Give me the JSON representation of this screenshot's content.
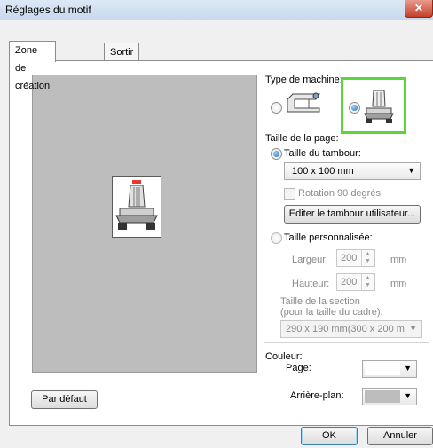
{
  "window": {
    "title": "Réglages du motif",
    "close_label": "✕"
  },
  "tabs": [
    {
      "label": "Zone de création"
    },
    {
      "label": "Sortir"
    }
  ],
  "machine_type": {
    "label": "Type de machine:",
    "options": [
      "flatbed-machine",
      "cap-machine"
    ],
    "selected": "cap-machine"
  },
  "page_size": {
    "label": "Taille de la page:",
    "hoop_size_label": "Taille du tambour:",
    "hoop_size_value": "100 x 100 mm",
    "rotation_label": "Rotation 90 degrés",
    "edit_hoop_button": "Editer le tambour utilisateur...",
    "custom_size_label": "Taille personnalisée:",
    "width_label": "Largeur:",
    "width_value": "200",
    "width_unit": "mm",
    "height_label": "Hauteur:",
    "height_value": "200",
    "height_unit": "mm",
    "section_label_line1": "Taille de la section",
    "section_label_line2": "(pour la taille du cadre):",
    "section_value": "290 x 190 mm(300 x 200 m"
  },
  "color": {
    "label": "Couleur:",
    "page_label": "Page:",
    "page_color": "#ffffff",
    "background_label": "Arrière-plan:",
    "background_color": "#bdbdbd"
  },
  "buttons": {
    "default": "Par défaut",
    "ok": "OK",
    "cancel": "Annuler"
  },
  "colors": {
    "highlight": "#5ad63a",
    "preview_bg": "#bdbdbd"
  }
}
